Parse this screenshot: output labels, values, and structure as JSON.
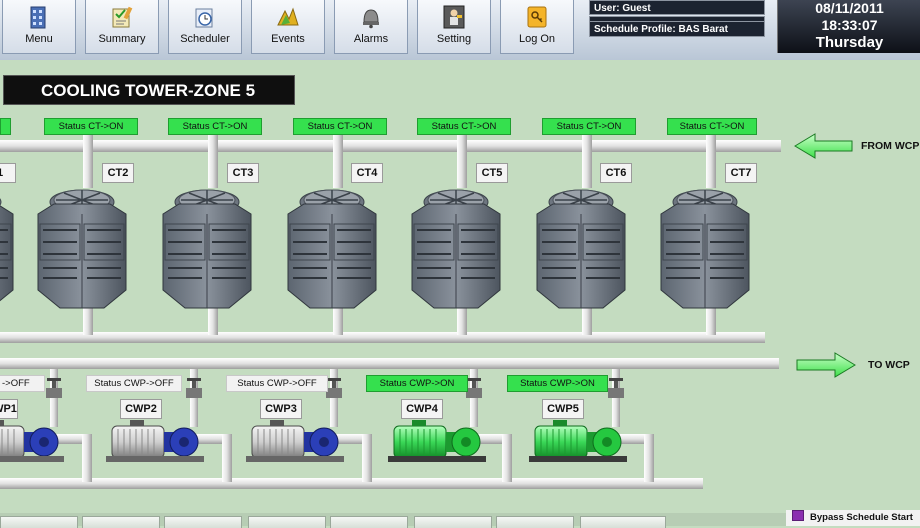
{
  "toolbar": {
    "buttons": [
      {
        "label": "Menu",
        "icon": "building-icon"
      },
      {
        "label": "Summary",
        "icon": "summary-icon"
      },
      {
        "label": "Scheduler",
        "icon": "clock-icon"
      },
      {
        "label": "Events",
        "icon": "events-icon"
      },
      {
        "label": "Alarms",
        "icon": "bell-icon"
      },
      {
        "label": "Setting",
        "icon": "settings-icon"
      },
      {
        "label": "Log On",
        "icon": "key-icon"
      }
    ]
  },
  "user_info": {
    "user": "User: Guest",
    "blank": "",
    "schedule": "Schedule Profile: BAS Barat"
  },
  "clock": {
    "date": "08/11/2011",
    "time": "18:33:07",
    "day": "Thursday"
  },
  "page_title": "COOLING TOWER-ZONE 5",
  "cooling_towers": [
    {
      "label": "1",
      "status": "",
      "state": "on"
    },
    {
      "label": "CT2",
      "status": "Status CT->ON",
      "state": "on"
    },
    {
      "label": "CT3",
      "status": "Status CT->ON",
      "state": "on"
    },
    {
      "label": "CT4",
      "status": "Status CT->ON",
      "state": "on"
    },
    {
      "label": "CT5",
      "status": "Status CT->ON",
      "state": "on"
    },
    {
      "label": "CT6",
      "status": "Status CT->ON",
      "state": "on"
    },
    {
      "label": "CT7",
      "status": "Status CT->ON",
      "state": "on"
    }
  ],
  "pumps": [
    {
      "label": "WP1",
      "status": "->OFF",
      "state": "off"
    },
    {
      "label": "CWP2",
      "status": "Status CWP->OFF",
      "state": "off"
    },
    {
      "label": "CWP3",
      "status": "Status CWP->OFF",
      "state": "off"
    },
    {
      "label": "CWP4",
      "status": "Status CWP->ON",
      "state": "on"
    },
    {
      "label": "CWP5",
      "status": "Status CWP->ON",
      "state": "on"
    }
  ],
  "flows": {
    "from": "FROM WCP",
    "to": "TO WCP"
  },
  "legend": {
    "label": "Bypass Schedule Start",
    "color": "#8b2fb0"
  },
  "colors": {
    "background": "#c4dcc0",
    "on": "#35e04e",
    "off": "#f2f2f2",
    "pipe": "#e8e8e8",
    "pump_off_motor": "#2b3fb8",
    "pump_on_motor": "#25c840"
  }
}
